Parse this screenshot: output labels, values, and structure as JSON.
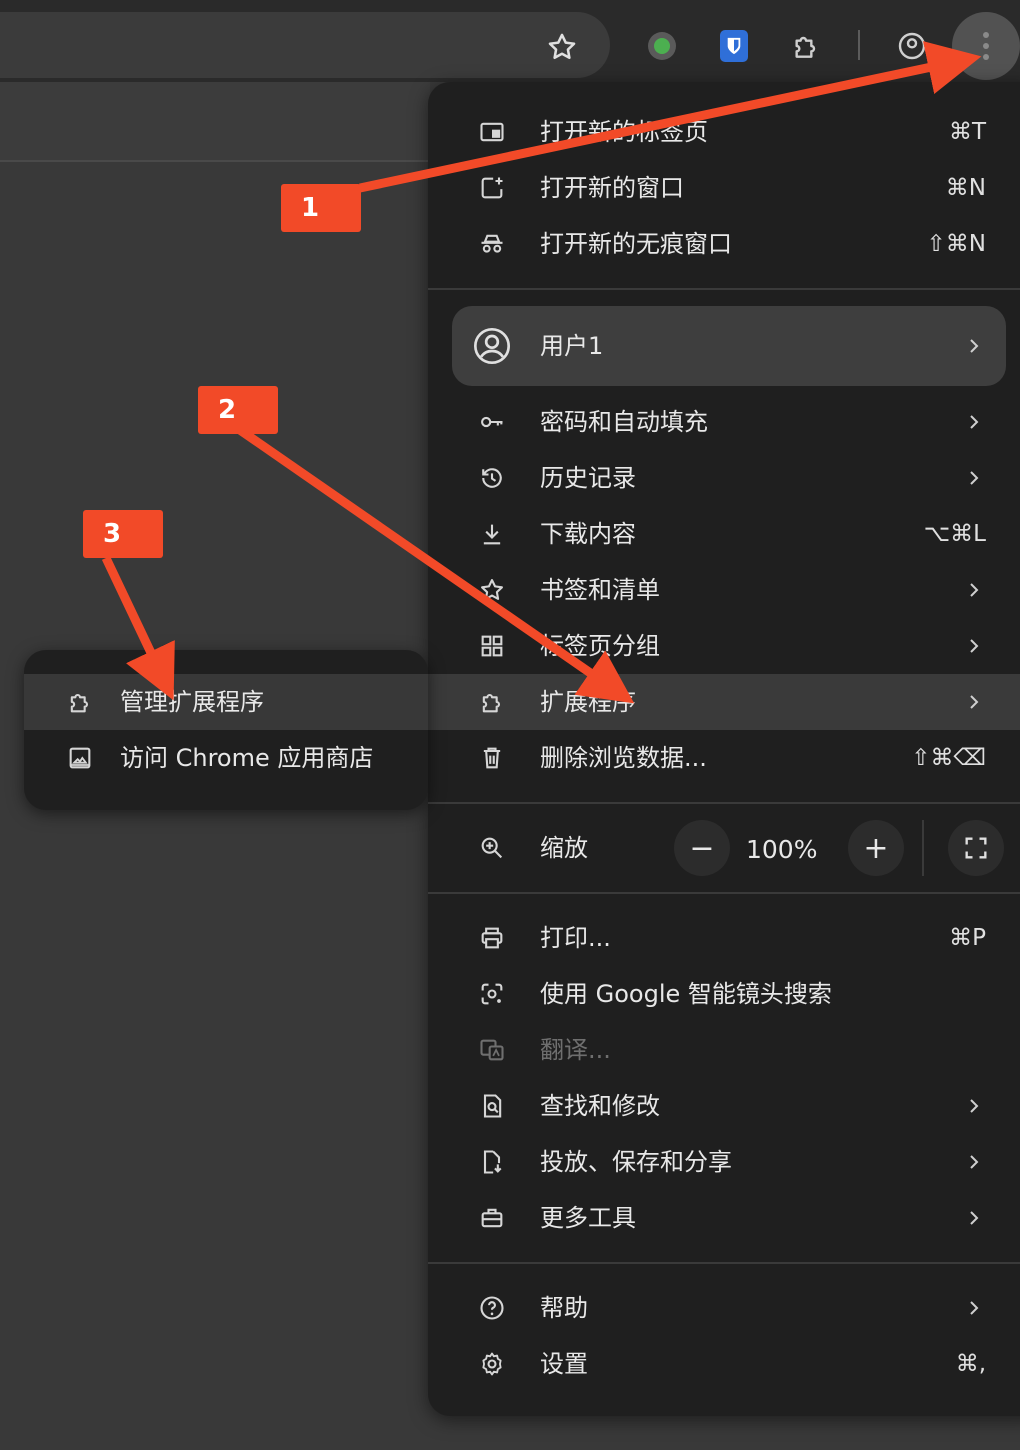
{
  "colors": {
    "annotation": "#f24a28",
    "menu_bg": "#1f1f1f",
    "highlight": "#3a3a3a"
  },
  "toolbar": {
    "icons": [
      "bookmark-star-icon",
      "green-dot-extension-icon",
      "bitwarden-shield-icon",
      "puzzle-extensions-icon",
      "profile-icon",
      "menu-dots-icon"
    ]
  },
  "menu": {
    "new_tab": {
      "label": "打开新的标签页",
      "shortcut": "⌘T"
    },
    "new_window": {
      "label": "打开新的窗口",
      "shortcut": "⌘N"
    },
    "incognito": {
      "label": "打开新的无痕窗口",
      "shortcut": "⇧⌘N"
    },
    "profile": {
      "label": "用户1"
    },
    "passwords": {
      "label": "密码和自动填充"
    },
    "history": {
      "label": "历史记录"
    },
    "downloads": {
      "label": "下载内容",
      "shortcut": "⌥⌘L"
    },
    "bookmarks": {
      "label": "书签和清单"
    },
    "tab_groups": {
      "label": "标签页分组"
    },
    "extensions": {
      "label": "扩展程序"
    },
    "clear_data": {
      "label": "删除浏览数据...",
      "shortcut": "⇧⌘⌫"
    },
    "zoom": {
      "label": "缩放",
      "minus": "−",
      "value": "100%",
      "plus": "+"
    },
    "print": {
      "label": "打印...",
      "shortcut": "⌘P"
    },
    "lens": {
      "label": "使用 Google 智能镜头搜索"
    },
    "translate": {
      "label": "翻译..."
    },
    "find_edit": {
      "label": "查找和修改"
    },
    "cast_save": {
      "label": "投放、保存和分享"
    },
    "more_tools": {
      "label": "更多工具"
    },
    "help": {
      "label": "帮助"
    },
    "settings": {
      "label": "设置",
      "shortcut": "⌘,"
    }
  },
  "submenu": {
    "manage_extensions": {
      "label": "管理扩展程序"
    },
    "web_store": {
      "label": "访问 Chrome 应用商店"
    }
  },
  "annotations": [
    "1",
    "2",
    "3"
  ]
}
